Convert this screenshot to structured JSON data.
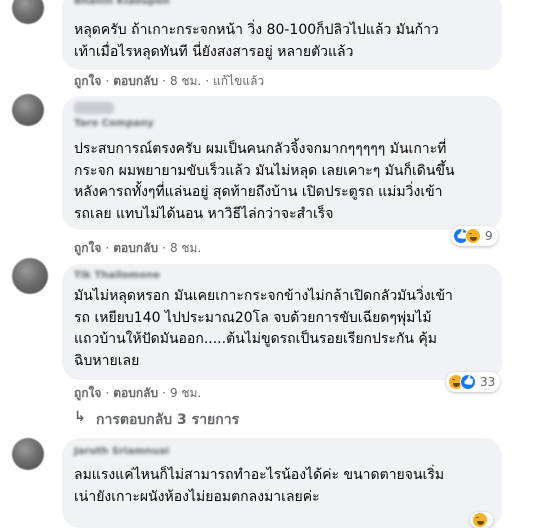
{
  "comments": [
    {
      "author": "Bhanin Kiaoupon",
      "text": "หลุดครับ ถ้าเกาะกระจกหน้า วิ่ง 80-100ก็ปลิวไปแล้ว มันก้าว\nเท้าเมื่อไรหลุดทันที นี่ยังสงสารอยู่ หลายตัวแล้ว",
      "like": "ถูกใจ",
      "reply": "ตอบกลับ",
      "time": "8 ชม.",
      "edited": "แก้ไขแล้ว"
    },
    {
      "author": "Taro Company",
      "text": "ประสบการณ์ตรงครับ ผมเป็นคนกลัวจิ้งจกมากๆๆๆๆๆ มันเกาะที่\nกระจก ผมพยายามขับเร็วแล้ว มันไม่หลุด เลยเคาะๆ มันก็เดินขึ้น\nหลังคารถทั้งๆที่แล่นอยู่ สุดท้ายถึงบ้าน เปิดประตูรถ แม่มวิ่งเข้า\nรถเลย แทบไม่ได้นอน หาวิธีไล่กว่าจะสำเร็จ",
      "like": "ถูกใจ",
      "reply": "ตอบกลับ",
      "time": "8 ชม.",
      "reaction_count": "9"
    },
    {
      "author": "Tik Thailomone",
      "text": "มันไม่หลุดหรอก มันเคยเกาะกระจกข้างไม่กล้าเปิดกลัวมันวิ่งเข้า\nรถ เหยียบ140 ไปประมาณ20โล จบด้วยการขับเฉียดๆพุ่มไม้\nแถวบ้านให้ปัดมันออก.....ต้นไม่ขูดรถเป็นรอยเรียกประกัน คุ้ม\nฉิบหายเลย",
      "like": "ถูกใจ",
      "reply": "ตอบกลับ",
      "time": "9 ชม.",
      "reaction_count": "33"
    },
    {
      "author": "Jaruth Sriamnuai",
      "text": "ลมแรงแค่ไหนก็ไม่สามารถทำอะไรน้องได้ค่ะ ขนาดตายจนเริ่ม\nเน่ายังเกาะผนังห้องไม่ยอมตกลงมาเลยค่ะ"
    }
  ],
  "replies_link": "การตอบกลับ 3 รายการ",
  "icons": {
    "like_reaction": "thumbs-up-icon",
    "haha_reaction": "laughing-face-icon",
    "replies_arrow": "reply-arrow-icon"
  },
  "colors": {
    "bubble": "#f0f2f5",
    "meta_text": "#65676b",
    "like_blue": "#1877f2",
    "haha_yellow": "#f7b125"
  }
}
